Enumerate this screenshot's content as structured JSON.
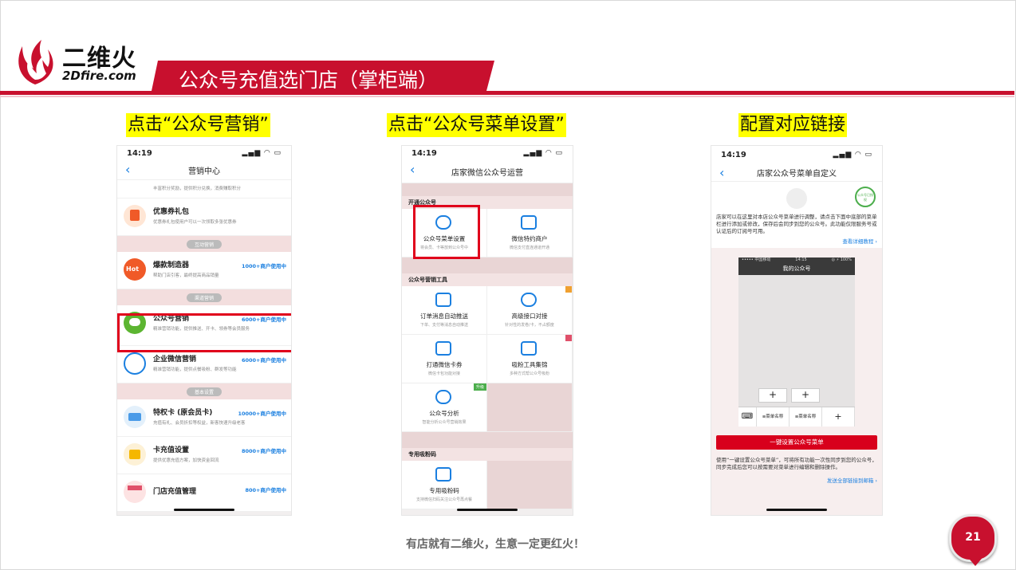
{
  "header": {
    "logo_cn": "二维火",
    "logo_en": "2Dfire.com",
    "title": "公众号充值选门店（掌柜端）"
  },
  "captions": [
    "点击“公众号营销”",
    "点击“公众号菜单设置”",
    "配置对应链接"
  ],
  "phone1": {
    "time": "14:19",
    "nav_title": "营销中心",
    "items": [
      {
        "title": "优惠券礼包",
        "desc": "优惠券礼包使用户可以一次领取多张优惠券",
        "meta": ""
      },
      {
        "section": "互动营销"
      },
      {
        "title": "爆款制造器",
        "desc": "帮助门店引客，最终提高商品销量",
        "meta": "1000+商户使用中"
      },
      {
        "section": "渠道营销"
      },
      {
        "title": "公众号营销",
        "desc": "精准营销功能，提供推送、开卡、领券等会员服务",
        "meta": "6000+商户使用中"
      },
      {
        "title": "企业微信营销",
        "desc": "精准营销功能，提供点餐吸粉、群发等功能",
        "meta": "6000+商户使用中"
      },
      {
        "section": "基本设置"
      },
      {
        "title": "特权卡 (原会员卡)",
        "desc": "充值有礼、会员折扣等权益，新客快速升级老客",
        "meta": "10000+商户使用中"
      },
      {
        "title": "卡充值设置",
        "desc": "提供优惠充值方案，加快资金回流",
        "meta": "8000+商户使用中"
      },
      {
        "title": "门店充值管理",
        "desc": "",
        "meta": "800+商户使用中"
      }
    ],
    "top_partial_desc": "丰富积分奖励，提供积分兑换，消费赚取积分",
    "hot_label": "Hot"
  },
  "phone2": {
    "time": "14:19",
    "nav_title": "店家微信公众号运营",
    "sections": [
      {
        "name": "开通公众号",
        "cells": [
          {
            "title": "公众号菜单设置",
            "desc": "将会员、卡等放到公众号中",
            "tag": ""
          },
          {
            "title": "微信特约商户",
            "desc": "微信支付直连通道开通",
            "tag": ""
          }
        ]
      },
      {
        "name": "公众号营销工具",
        "cells": [
          {
            "title": "订单消息自动推送",
            "desc": "下单、支付等消息自动推送",
            "tag": ""
          },
          {
            "title": "高级接口对接",
            "desc": "针对性的发卷/卡，不占额度",
            "tag": ""
          },
          {
            "title": "打通微信卡券",
            "desc": "微信卡包功能对接",
            "tag": ""
          },
          {
            "title": "吸粉工具集锦",
            "desc": "多种方式帮公众号吸粉",
            "tag": ""
          },
          {
            "title": "公众号分析",
            "desc": "智能分析公众号营销效果",
            "tag": "升级"
          }
        ]
      },
      {
        "name": "专用吸粉码",
        "cells": [
          {
            "title": "专用吸粉码",
            "desc": "支持微信扫码关注公众号再点餐",
            "tag": ""
          }
        ]
      }
    ]
  },
  "phone3": {
    "time": "14:19",
    "nav_title": "店家公众号菜单自定义",
    "desc": "店家可以在这里对本店公众号菜单进行调整，请点击下面中底部的菜单栏进行添加或修改，保存后会同步到您的公众号。此功能仅限服务号或认证后的订阅号可用。",
    "tutorial_link": "查看详细教程 ›",
    "mini_status_left": "••••• 中国移动 ",
    "mini_time": "14:15",
    "mini_status_right": "◎ ⚡ 100%",
    "mini_title": "我的公众号",
    "menu_items": [
      "≡菜单名称",
      "≡菜单名称",
      "+"
    ],
    "plus": "+",
    "keyboard": "⌨",
    "button": "一键设置公众号菜单",
    "note": "使用“一键设置公众号菜单”，可将所有功能一次性同步到您的公众号，同步完成后您可以按需要对菜单进行编辑和删除操作。",
    "send_link": "发送全部链接到邮箱 ›",
    "badge": "公众号已授权"
  },
  "footer": {
    "slogan": "有店就有二维火，生意一定更红火！",
    "page_number": "21"
  },
  "colors": {
    "brand_red": "#c8102e",
    "highlight_yellow": "#ffff00",
    "link_blue": "#1a7fe0"
  }
}
